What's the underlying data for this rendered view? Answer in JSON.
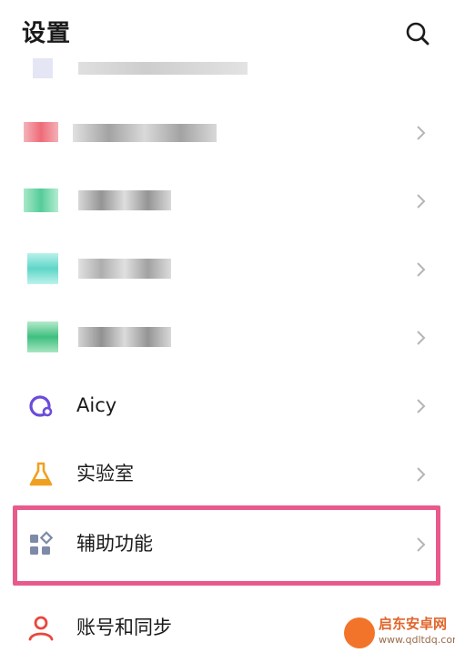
{
  "header": {
    "title": "设置"
  },
  "menu": {
    "items": [
      {
        "label": "Aicy"
      },
      {
        "label": "实验室"
      },
      {
        "label": "辅助功能"
      },
      {
        "label": "账号和同步"
      }
    ]
  },
  "watermark": {
    "brand": "启东安卓网",
    "url": "www.qdltdq.com"
  },
  "colors": {
    "highlight": "#e95a8c",
    "accent": "#6b4cd9",
    "lab_icon": "#f0a020",
    "account_icon": "#e8483c"
  }
}
